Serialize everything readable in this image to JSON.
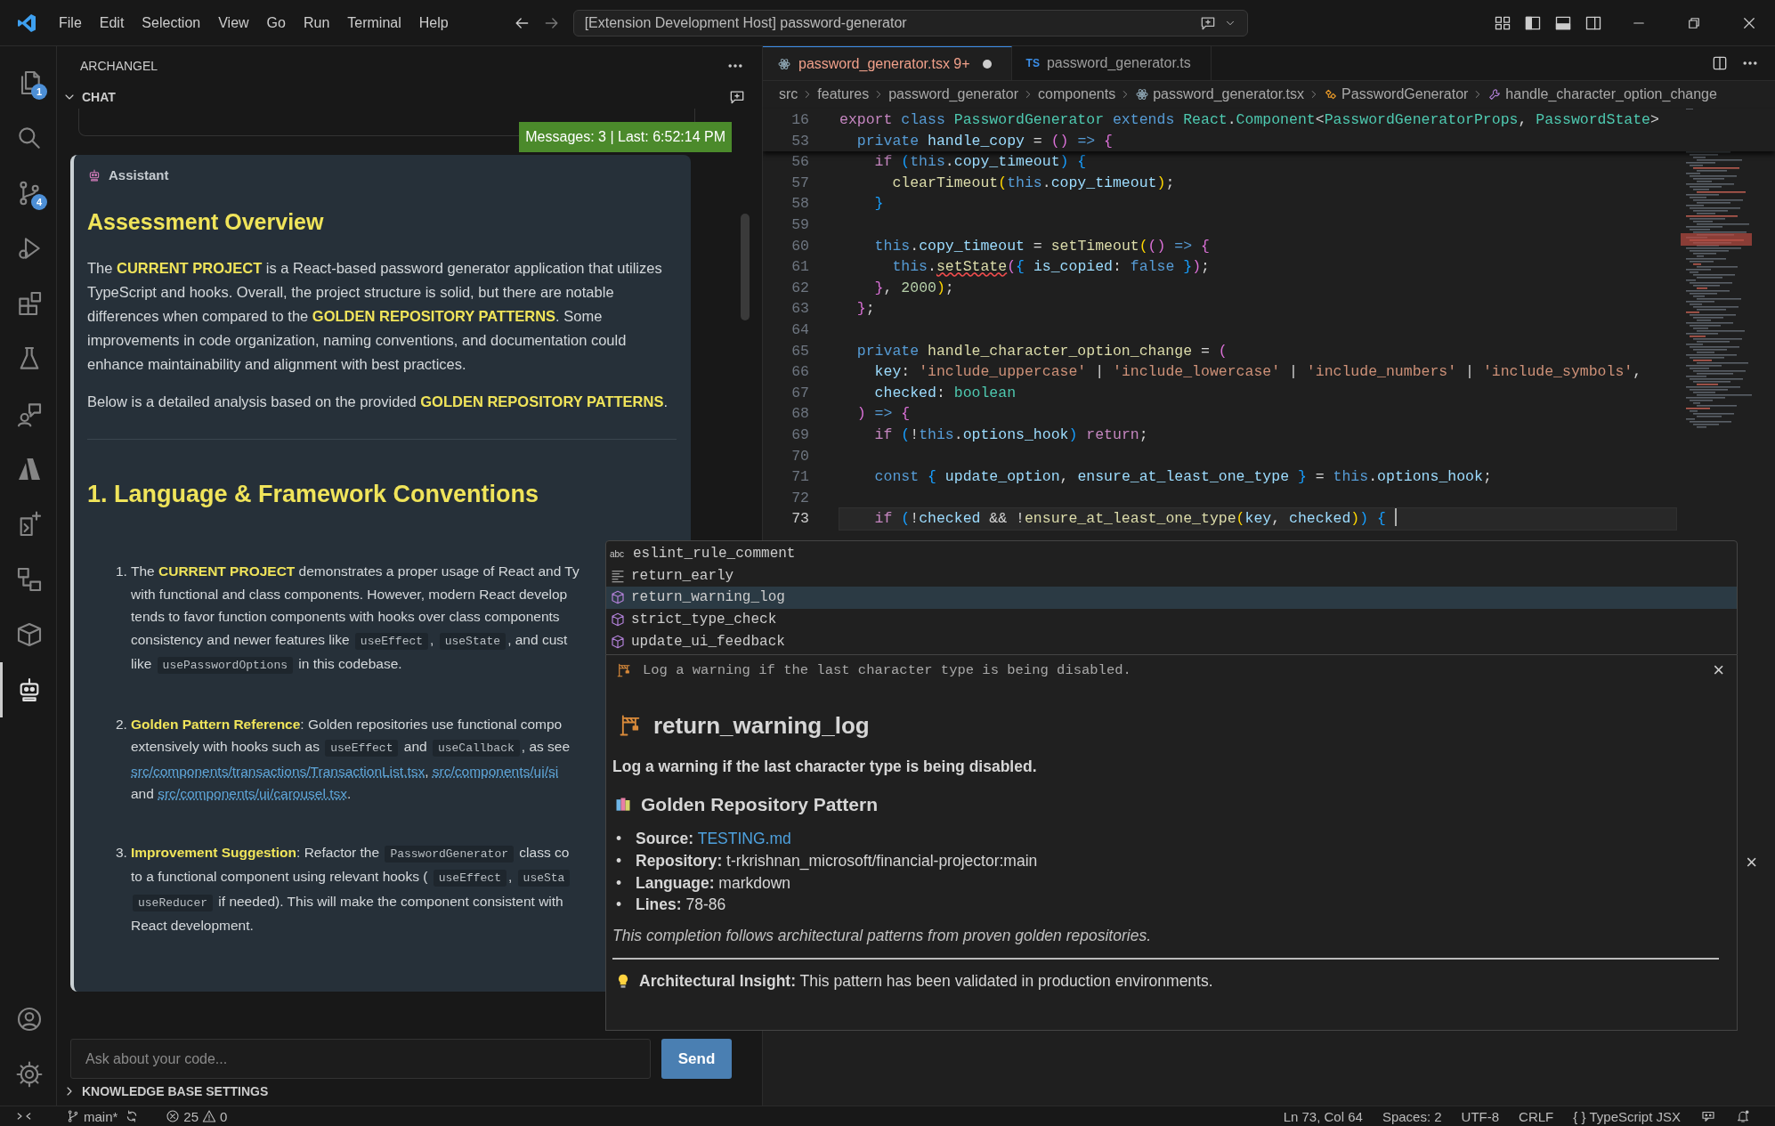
{
  "title_bar": {
    "menus": [
      "File",
      "Edit",
      "Selection",
      "View",
      "Go",
      "Run",
      "Terminal",
      "Help"
    ],
    "command_center": "[Extension Development Host] password-generator"
  },
  "activity_bar": {
    "items": [
      {
        "kind": "files",
        "badge": "1",
        "selected": false
      },
      {
        "kind": "search",
        "selected": false
      },
      {
        "kind": "source-control",
        "badge": "4",
        "selected": false
      },
      {
        "kind": "run-debug",
        "selected": false
      },
      {
        "kind": "extensions",
        "selected": false
      },
      {
        "kind": "flask",
        "selected": false
      },
      {
        "kind": "chat-person",
        "selected": false
      },
      {
        "kind": "azure",
        "selected": false
      },
      {
        "kind": "doc-sparkle",
        "selected": false
      },
      {
        "kind": "flow",
        "selected": false
      },
      {
        "kind": "package",
        "selected": false
      },
      {
        "kind": "robot",
        "selected": true
      }
    ],
    "bottom_items": [
      {
        "kind": "account"
      },
      {
        "kind": "settings"
      }
    ]
  },
  "sidebar": {
    "title": "ARCHANGEL",
    "section": {
      "label": "CHAT",
      "expanded": true
    },
    "status": "Messages: 3 | Last: 6:52:14 PM",
    "message": {
      "author": "Assistant",
      "heading": "Assessment Overview",
      "paragraphs": [
        "The **CURRENT PROJECT** is a React-based password generator application that utilizes TypeScript and hooks. Overall, the project structure is solid, but there are notable differences when compared to the **GOLDEN REPOSITORY PATTERNS**. Some improvements in code organization, naming conventions, and documentation could enhance maintainability and alignment with best practices.",
        "Below is a detailed analysis based on the provided **GOLDEN REPOSITORY PATTERNS**."
      ],
      "section_heading": "1. Language & Framework Conventions",
      "list": [
        {
          "number": "1.",
          "lines": [
            [
              {
                "kind": "text",
                "text": "The "
              },
              {
                "kind": "strong",
                "text": "CURRENT PROJECT"
              },
              {
                "kind": "text",
                "text": " demonstrates a proper usage of React and Ty"
              }
            ],
            [
              {
                "kind": "text",
                "text": "with functional and class components. However, modern React develop"
              }
            ],
            [
              {
                "kind": "text",
                "text": "tends to favor function components with hooks over class components"
              }
            ],
            [
              {
                "kind": "text",
                "text": "consistency and newer features like "
              },
              {
                "kind": "code",
                "text": "useEffect"
              },
              {
                "kind": "text",
                "text": ", "
              },
              {
                "kind": "code",
                "text": "useState"
              },
              {
                "kind": "text",
                "text": ", and cust"
              }
            ],
            [
              {
                "kind": "text",
                "text": "like "
              },
              {
                "kind": "code",
                "text": "usePasswordOptions"
              },
              {
                "kind": "text",
                "text": " in this codebase."
              }
            ]
          ]
        },
        {
          "number": "2.",
          "lines": [
            [
              {
                "kind": "strong",
                "text": "Golden Pattern Reference"
              },
              {
                "kind": "text",
                "text": ": Golden repositories use functional compo"
              }
            ],
            [
              {
                "kind": "text",
                "text": "extensively with hooks such as "
              },
              {
                "kind": "code",
                "text": "useEffect"
              },
              {
                "kind": "text",
                "text": " and "
              },
              {
                "kind": "code",
                "text": "useCallback"
              },
              {
                "kind": "text",
                "text": ", as see"
              }
            ],
            [
              {
                "kind": "link",
                "text": "src/components/transactions/TransactionList.tsx"
              },
              {
                "kind": "text",
                "text": ", "
              },
              {
                "kind": "link",
                "text": "src/components/ui/si"
              }
            ],
            [
              {
                "kind": "text",
                "text": "and "
              },
              {
                "kind": "link",
                "text": "src/components/ui/carousel.tsx"
              },
              {
                "kind": "text",
                "text": "."
              }
            ]
          ]
        },
        {
          "number": "3.",
          "lines": [
            [
              {
                "kind": "strong",
                "text": "Improvement Suggestion"
              },
              {
                "kind": "text",
                "text": ": Refactor the "
              },
              {
                "kind": "code",
                "text": "PasswordGenerator"
              },
              {
                "kind": "text",
                "text": " class co"
              }
            ],
            [
              {
                "kind": "text",
                "text": "to a functional component using relevant hooks ( "
              },
              {
                "kind": "code",
                "text": "useEffect"
              },
              {
                "kind": "text",
                "text": ", "
              },
              {
                "kind": "code",
                "text": "useSta"
              }
            ],
            [
              {
                "kind": "code",
                "text": "useReducer"
              },
              {
                "kind": "text",
                "text": " if needed). This will make the component consistent with"
              }
            ],
            [
              {
                "kind": "text",
                "text": "React development."
              }
            ]
          ]
        }
      ]
    },
    "input": {
      "placeholder": "Ask about your code..."
    },
    "send": "Send",
    "knowledge_base": {
      "label": "KNOWLEDGE BASE SETTINGS",
      "expanded": false
    }
  },
  "editor": {
    "tabs": [
      {
        "kind": "tsx",
        "label": "password_generator.tsx",
        "badge": "9+",
        "modified": true,
        "selected": true
      },
      {
        "kind": "ts",
        "icon_text": "TS",
        "label": "password_generator.ts",
        "modified": false,
        "selected": false
      }
    ],
    "breadcrumbs": [
      {
        "kind": "folder",
        "label": "src"
      },
      {
        "kind": "folder",
        "label": "features"
      },
      {
        "kind": "folder",
        "label": "password_generator"
      },
      {
        "kind": "folder",
        "label": "components"
      },
      {
        "kind": "file",
        "label": "password_generator.tsx"
      },
      {
        "kind": "class",
        "label": "PasswordGenerator"
      },
      {
        "kind": "method",
        "label": "handle_character_option_change"
      }
    ],
    "sticky_lines": [
      {
        "number": "16",
        "tokens": [
          {
            "kind": "ctl",
            "text": "export "
          },
          {
            "kind": "kw",
            "text": "class "
          },
          {
            "kind": "type",
            "text": "PasswordGenerator "
          },
          {
            "kind": "kw",
            "text": "extends "
          },
          {
            "kind": "type",
            "text": "React"
          },
          {
            "kind": "pl",
            "text": "."
          },
          {
            "kind": "type",
            "text": "Component"
          },
          {
            "kind": "pl",
            "text": "<"
          },
          {
            "kind": "type",
            "text": "PasswordGeneratorProps"
          },
          {
            "kind": "pl",
            "text": ", "
          },
          {
            "kind": "type",
            "text": "PasswordState"
          },
          {
            "kind": "pl",
            "text": ">"
          }
        ]
      },
      {
        "number": "53",
        "tokens": [
          {
            "kind": "kw",
            "text": "  private "
          },
          {
            "kind": "var",
            "text": "handle_copy"
          },
          {
            "kind": "pl",
            "text": " = "
          },
          {
            "kind": "br2",
            "text": "()"
          },
          {
            "kind": "kw",
            "text": " => "
          },
          {
            "kind": "br2",
            "text": "{"
          }
        ]
      }
    ],
    "lines": [
      {
        "number": "56",
        "selected": false,
        "tokens": [
          {
            "kind": "ctl",
            "text": "    if "
          },
          {
            "kind": "br3",
            "text": "("
          },
          {
            "kind": "kw",
            "text": "this"
          },
          {
            "kind": "pl",
            "text": "."
          },
          {
            "kind": "var",
            "text": "copy_timeout"
          },
          {
            "kind": "br3",
            "text": ") {"
          }
        ]
      },
      {
        "number": "57",
        "selected": false,
        "tokens": [
          {
            "kind": "fn",
            "text": "      clearTimeout"
          },
          {
            "kind": "br",
            "text": "("
          },
          {
            "kind": "kw",
            "text": "this"
          },
          {
            "kind": "pl",
            "text": "."
          },
          {
            "kind": "var",
            "text": "copy_timeout"
          },
          {
            "kind": "br",
            "text": ")"
          },
          {
            "kind": "pl",
            "text": ";"
          }
        ]
      },
      {
        "number": "58",
        "selected": false,
        "tokens": [
          {
            "kind": "br3",
            "text": "    }"
          }
        ]
      },
      {
        "number": "59",
        "selected": false
      },
      {
        "number": "60",
        "selected": false,
        "tokens": [
          {
            "kind": "kw",
            "text": "    this"
          },
          {
            "kind": "pl",
            "text": "."
          },
          {
            "kind": "var",
            "text": "copy_timeout"
          },
          {
            "kind": "pl",
            "text": " = "
          },
          {
            "kind": "fn",
            "text": "setTimeout"
          },
          {
            "kind": "br",
            "text": "("
          },
          {
            "kind": "br2",
            "text": "()"
          },
          {
            "kind": "kw",
            "text": " => "
          },
          {
            "kind": "br2",
            "text": "{"
          }
        ]
      },
      {
        "number": "61",
        "selected": false,
        "tokens": [
          {
            "kind": "kw",
            "text": "      this"
          },
          {
            "kind": "pl",
            "text": "."
          },
          {
            "kind": "fn_error",
            "text": "setState"
          },
          {
            "kind": "br2",
            "text": "("
          },
          {
            "kind": "br3",
            "text": "{ "
          },
          {
            "kind": "var",
            "text": "is_copied"
          },
          {
            "kind": "pl",
            "text": ": "
          },
          {
            "kind": "kw",
            "text": "false"
          },
          {
            "kind": "br3",
            "text": " }"
          },
          {
            "kind": "br2",
            "text": ")"
          },
          {
            "kind": "pl",
            "text": ";"
          }
        ]
      },
      {
        "number": "62",
        "selected": false,
        "tokens": [
          {
            "kind": "br2",
            "text": "    }"
          },
          {
            "kind": "pl",
            "text": ", "
          },
          {
            "kind": "num",
            "text": "2000"
          },
          {
            "kind": "br",
            "text": ")"
          },
          {
            "kind": "pl",
            "text": ";"
          }
        ]
      },
      {
        "number": "63",
        "selected": false,
        "tokens": [
          {
            "kind": "br2",
            "text": "  }"
          },
          {
            "kind": "pl",
            "text": ";"
          }
        ]
      },
      {
        "number": "64",
        "selected": false
      },
      {
        "number": "65",
        "selected": false,
        "tokens": [
          {
            "kind": "kw",
            "text": "  private "
          },
          {
            "kind": "fn",
            "text": "handle_character_option_change"
          },
          {
            "kind": "pl",
            "text": " = "
          },
          {
            "kind": "br2",
            "text": "("
          }
        ]
      },
      {
        "number": "66",
        "selected": false,
        "tokens": [
          {
            "kind": "var",
            "text": "    key"
          },
          {
            "kind": "pl",
            "text": ": "
          },
          {
            "kind": "str",
            "text": "'include_uppercase'"
          },
          {
            "kind": "pl",
            "text": " | "
          },
          {
            "kind": "str",
            "text": "'include_lowercase'"
          },
          {
            "kind": "pl",
            "text": " | "
          },
          {
            "kind": "str",
            "text": "'include_numbers'"
          },
          {
            "kind": "pl",
            "text": " | "
          },
          {
            "kind": "str",
            "text": "'include_symbols'"
          },
          {
            "kind": "pl",
            "text": ","
          }
        ]
      },
      {
        "number": "67",
        "selected": false,
        "tokens": [
          {
            "kind": "var",
            "text": "    checked"
          },
          {
            "kind": "pl",
            "text": ": "
          },
          {
            "kind": "type",
            "text": "boolean"
          }
        ]
      },
      {
        "number": "68",
        "selected": false,
        "tokens": [
          {
            "kind": "br2",
            "text": "  )"
          },
          {
            "kind": "kw",
            "text": " => "
          },
          {
            "kind": "br2",
            "text": "{"
          }
        ]
      },
      {
        "number": "69",
        "selected": false,
        "tokens": [
          {
            "kind": "ctl",
            "text": "    if "
          },
          {
            "kind": "br3",
            "text": "("
          },
          {
            "kind": "pl",
            "text": "!"
          },
          {
            "kind": "kw",
            "text": "this"
          },
          {
            "kind": "pl",
            "text": "."
          },
          {
            "kind": "var",
            "text": "options_hook"
          },
          {
            "kind": "br3",
            "text": ")"
          },
          {
            "kind": "ctl",
            "text": " return"
          },
          {
            "kind": "pl",
            "text": ";"
          }
        ]
      },
      {
        "number": "70",
        "selected": false
      },
      {
        "number": "71",
        "selected": false,
        "tokens": [
          {
            "kind": "kw",
            "text": "    const "
          },
          {
            "kind": "br3",
            "text": "{ "
          },
          {
            "kind": "var",
            "text": "update_option"
          },
          {
            "kind": "pl",
            "text": ", "
          },
          {
            "kind": "var",
            "text": "ensure_at_least_one_type"
          },
          {
            "kind": "br3",
            "text": " }"
          },
          {
            "kind": "pl",
            "text": " = "
          },
          {
            "kind": "kw",
            "text": "this"
          },
          {
            "kind": "pl",
            "text": "."
          },
          {
            "kind": "var",
            "text": "options_hook"
          },
          {
            "kind": "pl",
            "text": ";"
          }
        ]
      },
      {
        "number": "72",
        "selected": false
      },
      {
        "number": "73",
        "selected": true,
        "tokens": [
          {
            "kind": "ctl",
            "text": "    if "
          },
          {
            "kind": "br3",
            "text": "("
          },
          {
            "kind": "pl",
            "text": "!"
          },
          {
            "kind": "var",
            "text": "checked"
          },
          {
            "kind": "pl",
            "text": " && !"
          },
          {
            "kind": "fn",
            "text": "ensure_at_least_one_type"
          },
          {
            "kind": "br",
            "text": "("
          },
          {
            "kind": "var",
            "text": "key"
          },
          {
            "kind": "pl",
            "text": ", "
          },
          {
            "kind": "var",
            "text": "checked"
          },
          {
            "kind": "br",
            "text": ")"
          },
          {
            "kind": "br3",
            "text": ") {"
          }
        ]
      }
    ],
    "background_close": "×"
  },
  "suggest": {
    "items": [
      {
        "kind": "word",
        "badge": "abc",
        "label": "eslint_rule_comment",
        "selected": false
      },
      {
        "kind": "snippet",
        "label": "return_early",
        "selected": false
      },
      {
        "kind": "module",
        "label": "return_warning_log",
        "selected": true
      },
      {
        "kind": "module",
        "label": "strict_type_check",
        "selected": false
      },
      {
        "kind": "module",
        "label": "update_ui_feedback",
        "selected": false
      }
    ],
    "details": {
      "summary": "Log a warning if the last character type is being disabled.",
      "close": "×",
      "title": "return_warning_log",
      "description": "Log a warning if the last character type is being disabled.",
      "pattern_heading": "Golden Repository Pattern",
      "facts": [
        {
          "kind": "link",
          "bullet": "•",
          "label": "Source:",
          "value": "TESTING.md"
        },
        {
          "kind": "text",
          "bullet": "•",
          "label": "Repository:",
          "value": "t-rkrishnan_microsoft/financial-projector:main"
        },
        {
          "kind": "text",
          "bullet": "•",
          "label": "Language:",
          "value": "markdown"
        },
        {
          "kind": "text",
          "bullet": "•",
          "label": "Lines:",
          "value": "78-86"
        }
      ],
      "note": "This completion follows architectural patterns from proven golden repositories.",
      "insight": "**Architectural Insight:** This pattern has been validated in production environments."
    }
  },
  "status_bar": {
    "branch": "main*",
    "errors": "25",
    "warnings": "0",
    "position": "Ln 73, Col 64",
    "spaces": "Spaces: 2",
    "encoding": "UTF-8",
    "eol": "CRLF",
    "language_icon": "{ }",
    "language": "TypeScript JSX"
  }
}
